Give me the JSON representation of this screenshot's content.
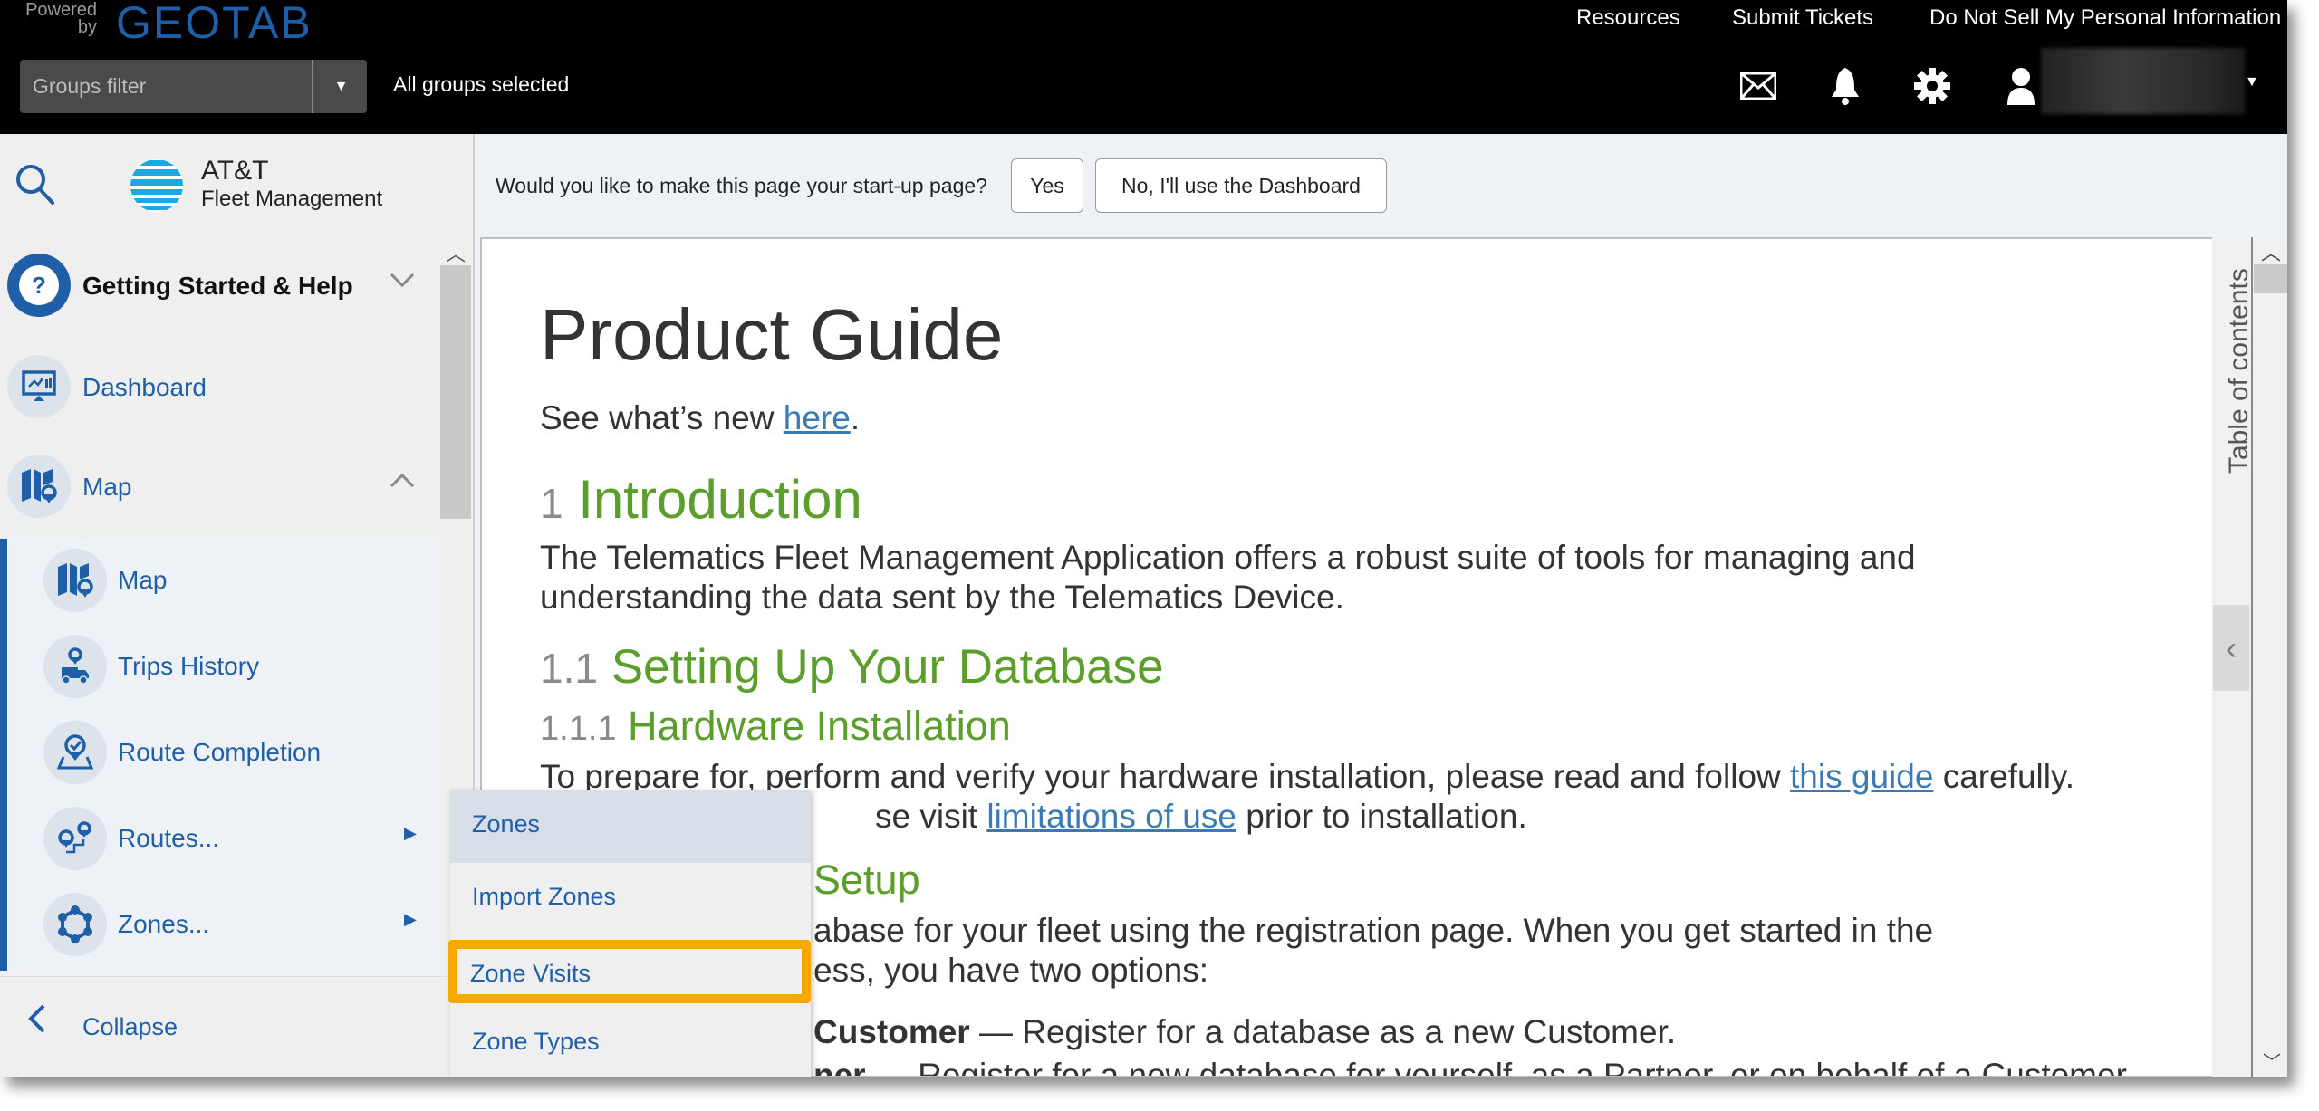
{
  "header": {
    "powered_by": "Powered by",
    "brand": "GEOTAB",
    "groups_filter_placeholder": "Groups filter",
    "groups_status": "All groups selected",
    "links": [
      "Resources",
      "Submit Tickets",
      "Do Not Sell My Personal Information"
    ],
    "icons": [
      "envelope-icon",
      "bell-icon",
      "gear-icon",
      "user-icon"
    ]
  },
  "sidebar": {
    "logo_title": "AT&T",
    "logo_subtitle": "Fleet Management",
    "items": [
      {
        "label": "Getting Started & Help",
        "icon": "help-icon",
        "expanded": false
      },
      {
        "label": "Dashboard",
        "icon": "dashboard-icon"
      },
      {
        "label": "Map",
        "icon": "map-icon",
        "expanded": true
      }
    ],
    "map_submenu": [
      {
        "label": "Map",
        "icon": "map-icon"
      },
      {
        "label": "Trips History",
        "icon": "trips-history-icon"
      },
      {
        "label": "Route Completion",
        "icon": "route-completion-icon"
      },
      {
        "label": "Routes...",
        "icon": "routes-icon",
        "has_submenu": true
      },
      {
        "label": "Zones...",
        "icon": "zones-icon",
        "has_submenu": true
      }
    ],
    "collapse_label": "Collapse"
  },
  "flyout": {
    "items": [
      "Zones",
      "Import Zones",
      "Zone Visits",
      "Zone Types"
    ],
    "hovered": "Zones",
    "highlighted": "Zone Visits"
  },
  "prompt": {
    "question": "Would you like to make this page your start-up page?",
    "yes_label": "Yes",
    "no_label": "No, I'll use the Dashboard"
  },
  "document": {
    "title": "Product Guide",
    "whats_new_prefix": "See what’s new ",
    "whats_new_link": "here",
    "whats_new_suffix": ".",
    "intro_num": "1",
    "intro_title": "Introduction",
    "intro_line1": "The Telematics Fleet Management Application offers a robust suite of tools for managing and",
    "intro_line2": "understanding the data sent by the Telematics Device.",
    "db_num": "1.1",
    "db_title": "Setting Up Your Database",
    "hw_num": "1.1.1",
    "hw_title": "Hardware Installation",
    "hw_line1_prefix": "To prepare for, perform and verify your hardware installation, please read and follow ",
    "hw_line1_link": "this guide",
    "hw_line1_suffix": " carefully.",
    "hw_line2_prefix": "se visit ",
    "hw_line2_link": "limitations of use",
    "hw_line2_suffix": " prior to installation.",
    "setup_title": "Setup",
    "setup_line1": "abase for your fleet using the registration page. When you get started in the",
    "setup_line2": "ess, you have two options:",
    "opt1_bold": "Customer",
    "opt1_text": " — Register for a database as a new Customer.",
    "opt2_bold": "ner",
    "opt2_text": " — Register for a new database for yourself, as a Partner, or on behalf of a Customer."
  },
  "toc": {
    "label": "Table of contents"
  },
  "colors": {
    "brand_blue": "#1f5fa8",
    "heading_green": "#5b9e2c",
    "highlight_orange": "#f5a800",
    "link_blue": "#3a7bb5"
  }
}
